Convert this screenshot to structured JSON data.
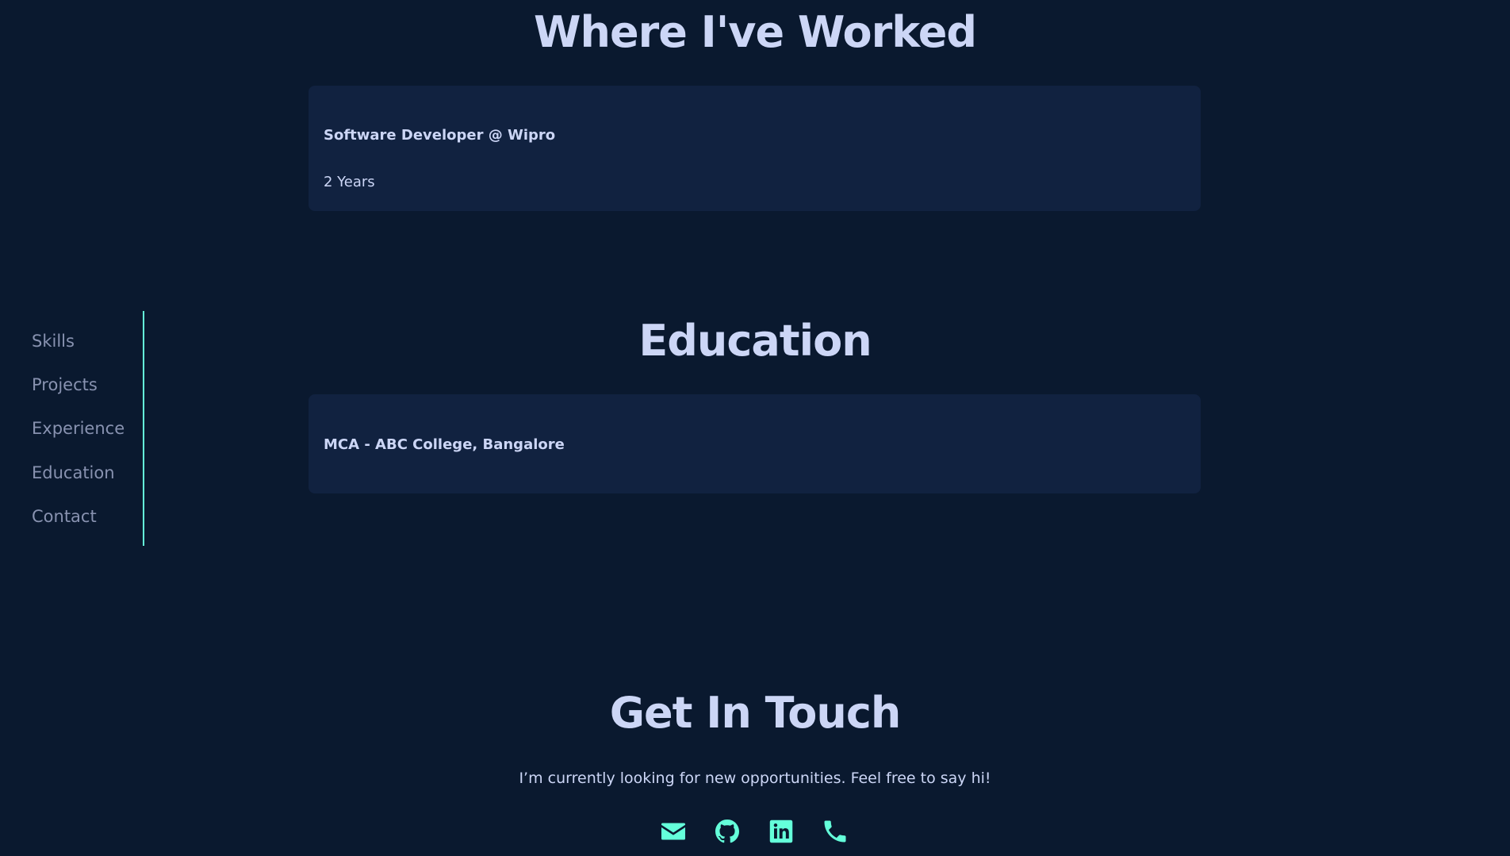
{
  "experience": {
    "title": "Where I've Worked",
    "items": [
      {
        "role": "Software Developer @ Wipro",
        "duration": "2 Years"
      }
    ]
  },
  "education": {
    "title": "Education",
    "items": [
      {
        "degree": "MCA - ABC College, Bangalore"
      }
    ]
  },
  "sidebar": {
    "items": [
      {
        "label": "Skills"
      },
      {
        "label": "Projects"
      },
      {
        "label": "Experience"
      },
      {
        "label": "Education"
      },
      {
        "label": "Contact"
      }
    ]
  },
  "contact": {
    "title": "Get In Touch",
    "text": "I’m currently looking for new opportunities. Feel free to say hi!",
    "icons": [
      "email-icon",
      "github-icon",
      "linkedin-icon",
      "phone-icon"
    ]
  },
  "colors": {
    "background": "#0a192f",
    "card": "#112240",
    "accent": "#64ffda",
    "heading": "#ccd6f6",
    "muted": "#8892b0"
  }
}
